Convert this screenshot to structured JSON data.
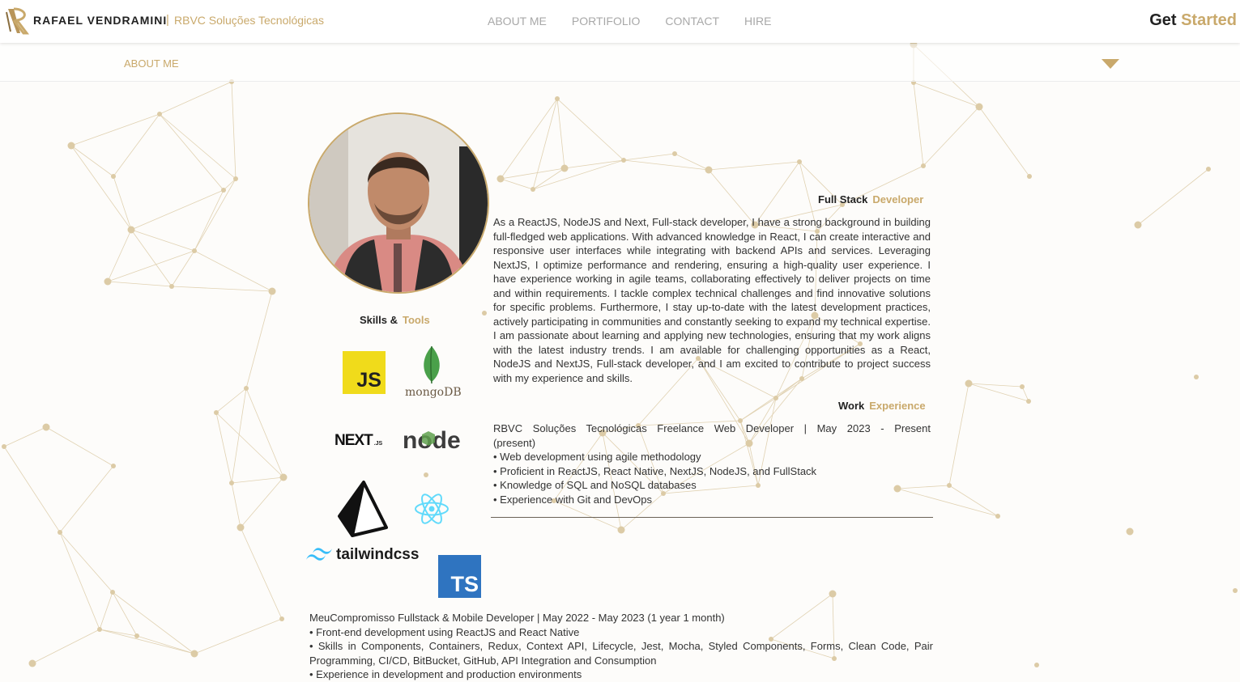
{
  "brand": {
    "name": "RAFAEL VENDRAMINI",
    "separator": "|",
    "subtitle": "RBVC Soluções Tecnológicas",
    "logo_icon": "rv-monogram-icon"
  },
  "nav": {
    "items": [
      "ABOUT ME",
      "PORTIFOLIO",
      "CONTACT",
      "HIRE"
    ]
  },
  "cta": {
    "word1": "Get",
    "word2": "Started"
  },
  "subheader": {
    "title": "ABOUT ME",
    "toggle_icon": "triangle-down-icon"
  },
  "profile": {
    "photo_icon": "profile-photo"
  },
  "role": {
    "part1": "Full Stack",
    "part2": "Developer"
  },
  "bio": "As a ReactJS, NodeJS and Next, Full-stack developer, I have a strong background in building full-fledged web applications. With advanced knowledge in React, I can create interactive and responsive user interfaces while integrating with backend APIs and services. Leveraging NextJS, I optimize performance and rendering, ensuring a high-quality user experience. I have experience working in agile teams, collaborating effectively to deliver projects on time and within requirements. I tackle complex technical challenges and find innovative solutions for specific problems. Furthermore, I stay up-to-date with the latest development practices, actively participating in communities and constantly seeking to expand my technical expertise. I am passionate about learning and applying new technologies, ensuring that my work aligns with the latest industry trends. I am available for challenging opportunities as a React, NodeJS and NextJS, Full-stack developer, and I am excited to contribute to project success with my experience and skills.",
  "skills": {
    "heading_part1": "Skills &",
    "heading_part2": "Tools",
    "js": "JS",
    "mongo": "mongoDB",
    "next": "NEXT",
    "next_suffix": ".JS",
    "node": "node",
    "tailwind": "tailwindcss",
    "ts": "TS"
  },
  "work": {
    "heading_part1": "Work",
    "heading_part2": "Experience",
    "jobs": [
      {
        "title_line1": "RBVC Soluções Tecnológicas Freelance Web Developer | May 2023 - Present",
        "title_line2": "(present)",
        "bullets": [
          "• Web development using agile methodology",
          "• Proficient in ReactJS, React Native, NextJS, NodeJS, and FullStack",
          "• Knowledge of SQL and NoSQL databases",
          "• Experience with Git and DevOps"
        ]
      },
      {
        "title": "MeuCompromisso Fullstack & Mobile Developer | May 2022 - May 2023 (1 year 1 month)",
        "bullets": [
          "• Front-end development using ReactJS and React Native",
          "• Skills in Components, Containers, Redux, Context API, Lifecycle, Jest, Mocha, Styled Components, Forms, Clean Code, Pair Programming, CI/CD, BitBucket, GitHub, API Integration and Consumption",
          "• Experience in development and production environments"
        ]
      }
    ]
  },
  "colors": {
    "accent": "#c9a96b",
    "text": "#222222",
    "nav_text": "#a8a8a8",
    "background": "#fdfcfa"
  }
}
